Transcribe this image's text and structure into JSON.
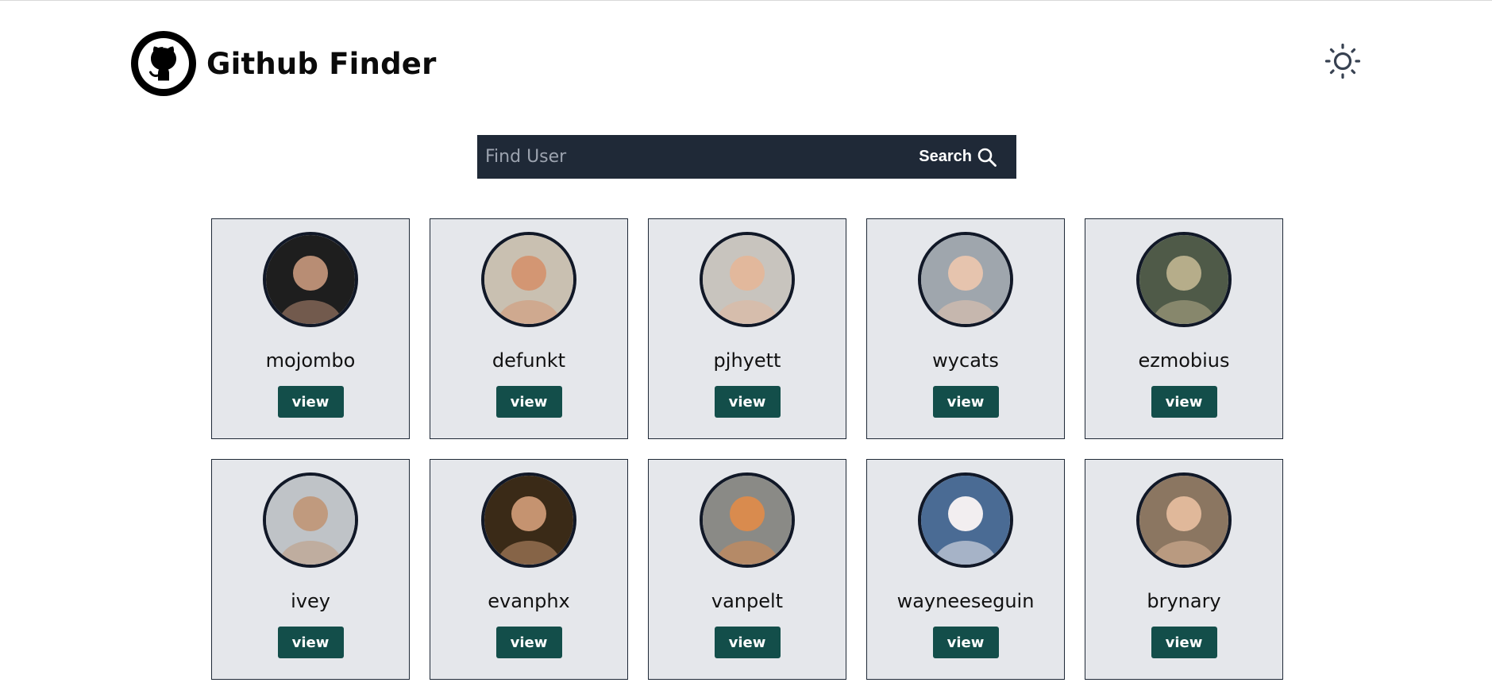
{
  "header": {
    "title": "Github Finder",
    "logo_icon": "github-octocat-icon",
    "theme_toggle_icon": "sun-icon"
  },
  "search": {
    "placeholder": "Find User",
    "value": "",
    "button_label": "Search",
    "button_icon": "magnifier-icon"
  },
  "colors": {
    "card_bg": "#e5e7eb",
    "button_bg": "#134e4a",
    "search_bg": "#1f2937"
  },
  "users": [
    {
      "login": "mojombo",
      "view_label": "view",
      "avatar_bg": "#1e1e1e",
      "avatar_fg": "#b88d74"
    },
    {
      "login": "defunkt",
      "view_label": "view",
      "avatar_bg": "#c9c0b1",
      "avatar_fg": "#d39673"
    },
    {
      "login": "pjhyett",
      "view_label": "view",
      "avatar_bg": "#c8c4be",
      "avatar_fg": "#e2b89c"
    },
    {
      "login": "wycats",
      "view_label": "view",
      "avatar_bg": "#9fa6ad",
      "avatar_fg": "#e6c4ae"
    },
    {
      "login": "ezmobius",
      "view_label": "view",
      "avatar_bg": "#4f5a48",
      "avatar_fg": "#b6ad8a"
    },
    {
      "login": "ivey",
      "view_label": "view",
      "avatar_bg": "#bfc3c7",
      "avatar_fg": "#c09a7e"
    },
    {
      "login": "evanphx",
      "view_label": "view",
      "avatar_bg": "#3a2a17",
      "avatar_fg": "#c59370"
    },
    {
      "login": "vanpelt",
      "view_label": "view",
      "avatar_bg": "#8a8a86",
      "avatar_fg": "#d98b4e"
    },
    {
      "login": "wayneeseguin",
      "view_label": "view",
      "avatar_bg": "#4a6b94",
      "avatar_fg": "#f2eef0"
    },
    {
      "login": "brynary",
      "view_label": "view",
      "avatar_bg": "#8b7661",
      "avatar_fg": "#e0b89a"
    }
  ]
}
